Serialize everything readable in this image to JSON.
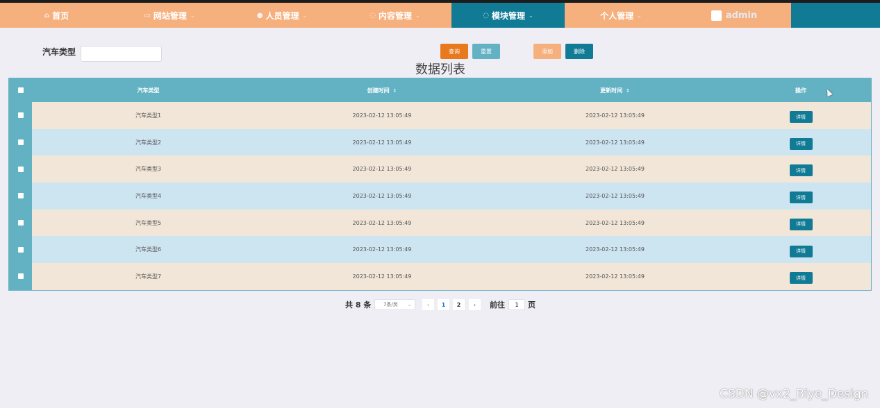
{
  "nav": {
    "items": [
      {
        "label": "首页",
        "icon": "home-icon",
        "glyph": "⌂",
        "caret": ""
      },
      {
        "label": "网站管理",
        "icon": "monitor-icon",
        "glyph": "▭",
        "caret": "⌄"
      },
      {
        "label": "人员管理",
        "icon": "user-icon",
        "glyph": "●",
        "caret": "⌄"
      },
      {
        "label": "内容管理",
        "icon": "chat-icon",
        "glyph": "◌",
        "caret": "⌄"
      },
      {
        "label": "模块管理",
        "icon": "comment-icon",
        "glyph": "◌",
        "caret": "⌄",
        "active": true
      },
      {
        "label": "个人管理",
        "icon": "",
        "glyph": "",
        "caret": "⌄"
      }
    ],
    "user": {
      "name": "admin",
      "icon": "avatar-image-icon"
    }
  },
  "search": {
    "label": "汽车类型",
    "value": "",
    "placeholder": ""
  },
  "buttons": {
    "query": "查询",
    "reset": "重置",
    "add": "添加",
    "delete": "删除"
  },
  "list_title": "数据列表",
  "table": {
    "headers": {
      "type": "汽车类型",
      "created": "创建时间",
      "updated": "更新时间",
      "op": "操作",
      "sort_glyph": "⇕"
    },
    "detail_label": "详情",
    "rows": [
      {
        "type": "汽车类型1",
        "created": "2023-02-12 13:05:49",
        "updated": "2023-02-12 13:05:49"
      },
      {
        "type": "汽车类型2",
        "created": "2023-02-12 13:05:49",
        "updated": "2023-02-12 13:05:49"
      },
      {
        "type": "汽车类型3",
        "created": "2023-02-12 13:05:49",
        "updated": "2023-02-12 13:05:49"
      },
      {
        "type": "汽车类型4",
        "created": "2023-02-12 13:05:49",
        "updated": "2023-02-12 13:05:49"
      },
      {
        "type": "汽车类型5",
        "created": "2023-02-12 13:05:49",
        "updated": "2023-02-12 13:05:49"
      },
      {
        "type": "汽车类型6",
        "created": "2023-02-12 13:05:49",
        "updated": "2023-02-12 13:05:49"
      },
      {
        "type": "汽车类型7",
        "created": "2023-02-12 13:05:49",
        "updated": "2023-02-12 13:05:49"
      }
    ]
  },
  "pagination": {
    "total": "共 8 条",
    "page_size": "7条/页",
    "prev": "‹",
    "pages": [
      "1",
      "2"
    ],
    "next": "›",
    "goto_label": "前往",
    "goto_value": "1",
    "page_unit": "页"
  },
  "watermark": "CSDN @vx2_Biye_Design",
  "colors": {
    "nav_bg": "#f5b07d",
    "nav_active": "#117b96",
    "table_header": "#62b2c4",
    "row_odd": "#f2e6d8",
    "row_even": "#cde4f1",
    "query_btn": "#e8791d",
    "reset_btn": "#62b2c4",
    "add_btn": "#f5b07d",
    "delete_btn": "#117b96"
  }
}
